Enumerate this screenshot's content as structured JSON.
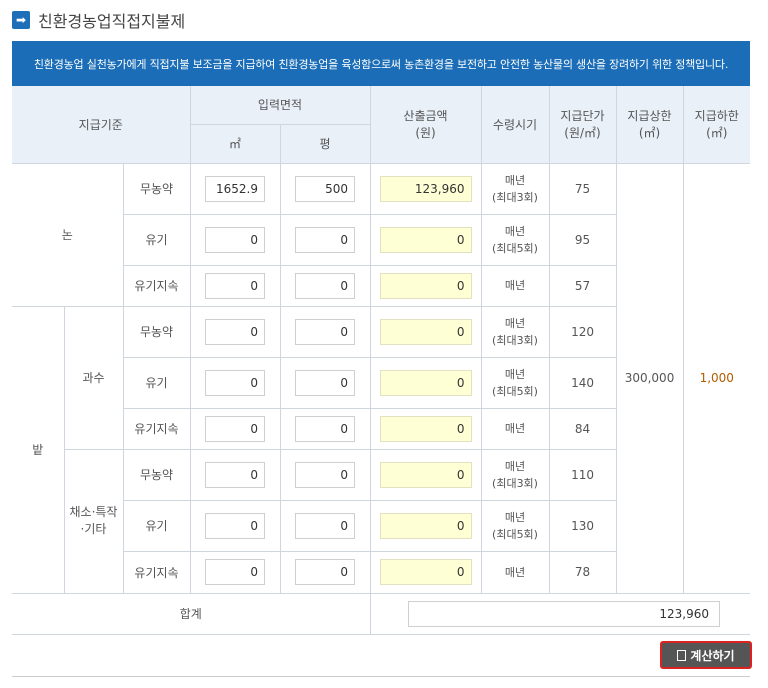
{
  "title": "친환경농업직접지불제",
  "banner": "친환경농업 실천농가에게 직접지불 보조금을 지급하여 친환경농업을 육성함으로써 농촌환경을 보전하고 안전한 농산물의 생산을 장려하기 위한 정책입니다.",
  "headers": {
    "standard": "지급기준",
    "area": "입력면적",
    "area_m2": "㎡",
    "area_pyeong": "평",
    "amount": "산출금액",
    "amount_unit": "(원)",
    "period": "수령시기",
    "unit_price": "지급단가",
    "unit_price_unit": "(원/㎡)",
    "upper": "지급상한",
    "upper_unit": "(㎡)",
    "lower": "지급하한",
    "lower_unit": "(㎡)"
  },
  "groups": {
    "paddy": "논",
    "field": "밭",
    "orchard": "과수",
    "vegetable": "채소·특작·기타"
  },
  "rows": [
    {
      "type": "무농약",
      "m2": "1652.9",
      "pyeong": "500",
      "amount": "123,960",
      "period1": "매년",
      "period2": "(최대3회)",
      "price": "75"
    },
    {
      "type": "유기",
      "m2": "0",
      "pyeong": "0",
      "amount": "0",
      "period1": "매년",
      "period2": "(최대5회)",
      "price": "95"
    },
    {
      "type": "유기지속",
      "m2": "0",
      "pyeong": "0",
      "amount": "0",
      "period1": "매년",
      "period2": "",
      "price": "57"
    },
    {
      "type": "무농약",
      "m2": "0",
      "pyeong": "0",
      "amount": "0",
      "period1": "매년",
      "period2": "(최대3회)",
      "price": "120"
    },
    {
      "type": "유기",
      "m2": "0",
      "pyeong": "0",
      "amount": "0",
      "period1": "매년",
      "period2": "(최대5회)",
      "price": "140"
    },
    {
      "type": "유기지속",
      "m2": "0",
      "pyeong": "0",
      "amount": "0",
      "period1": "매년",
      "period2": "",
      "price": "84"
    },
    {
      "type": "무농약",
      "m2": "0",
      "pyeong": "0",
      "amount": "0",
      "period1": "매년",
      "period2": "(최대3회)",
      "price": "110"
    },
    {
      "type": "유기",
      "m2": "0",
      "pyeong": "0",
      "amount": "0",
      "period1": "매년",
      "period2": "(최대5회)",
      "price": "130"
    },
    {
      "type": "유기지속",
      "m2": "0",
      "pyeong": "0",
      "amount": "0",
      "period1": "매년",
      "period2": "",
      "price": "78"
    }
  ],
  "upper_limit": "300,000",
  "lower_limit": "1,000",
  "total_label": "합계",
  "total_value": "123,960",
  "calc_button": "계산하기"
}
